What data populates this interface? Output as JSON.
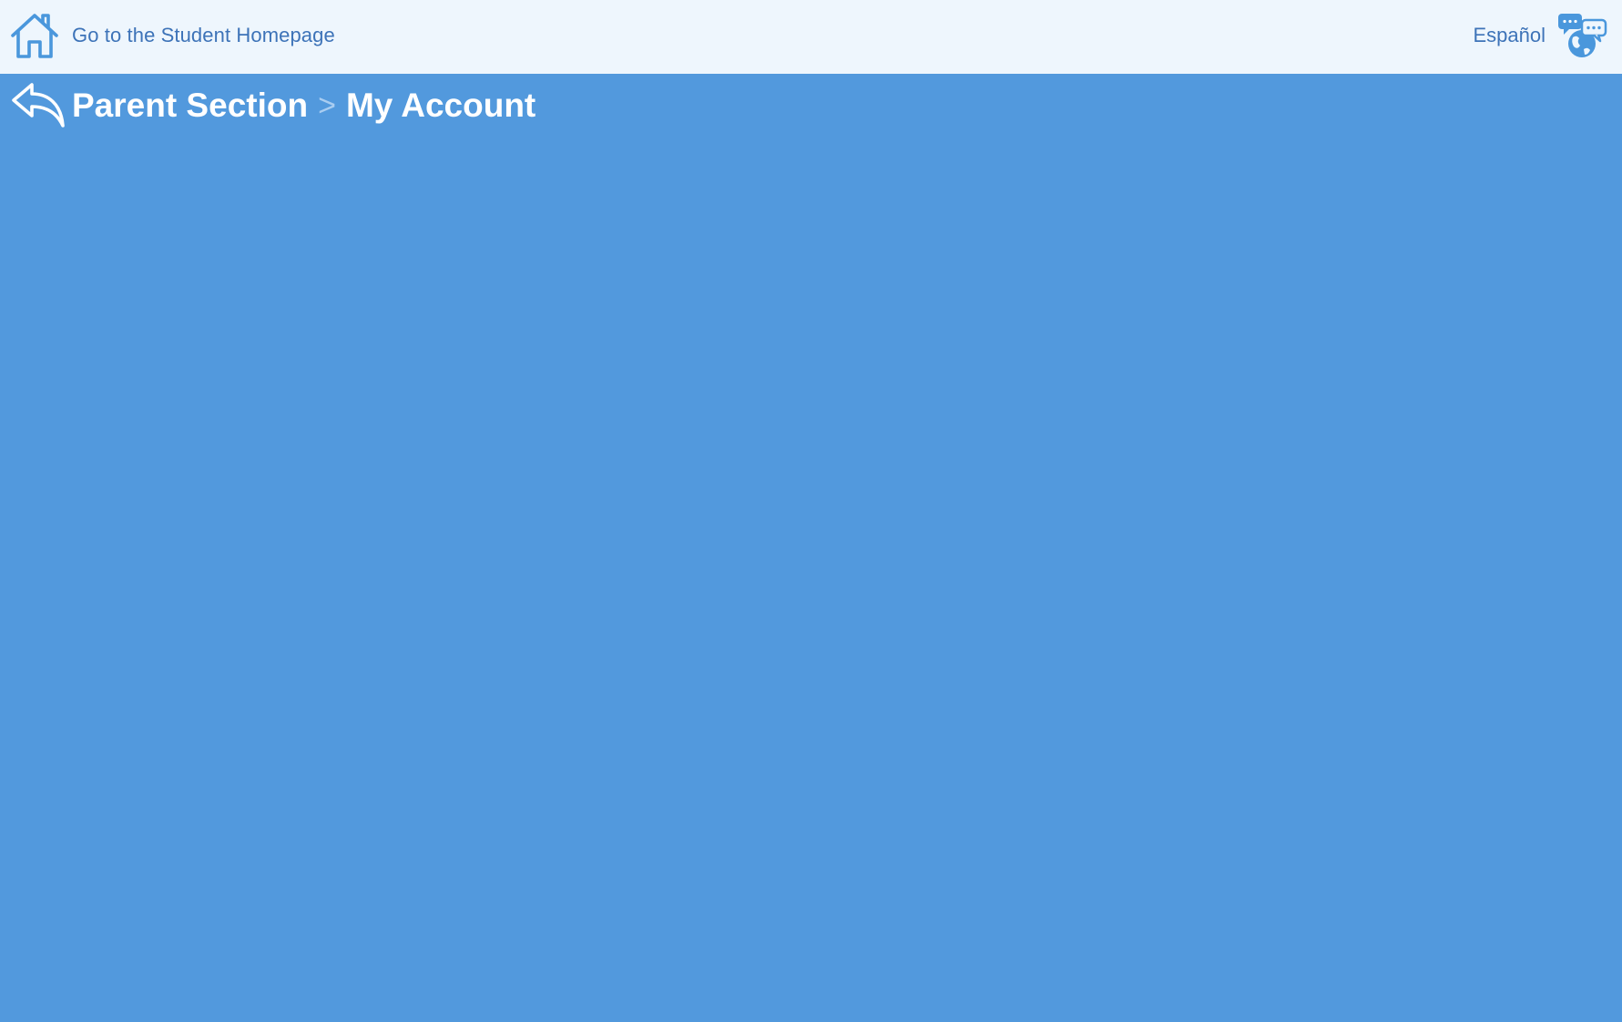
{
  "header": {
    "home_label": "Go to the Student Homepage",
    "home_icon": "house-icon",
    "language_label": "Español",
    "language_icon": "globe-chat-icon"
  },
  "breadcrumb": {
    "back_icon": "reply-arrow-icon",
    "items": [
      {
        "label": "Parent Section"
      },
      {
        "label": "My Account"
      }
    ],
    "separator": ">"
  },
  "colors": {
    "page_background": "#5299dd",
    "header_background": "#eef6fd",
    "header_text": "#3d73b8",
    "icon_blue": "#4a97dc",
    "breadcrumb_text": "#ffffff",
    "breadcrumb_separator": "#a9cdf1"
  }
}
